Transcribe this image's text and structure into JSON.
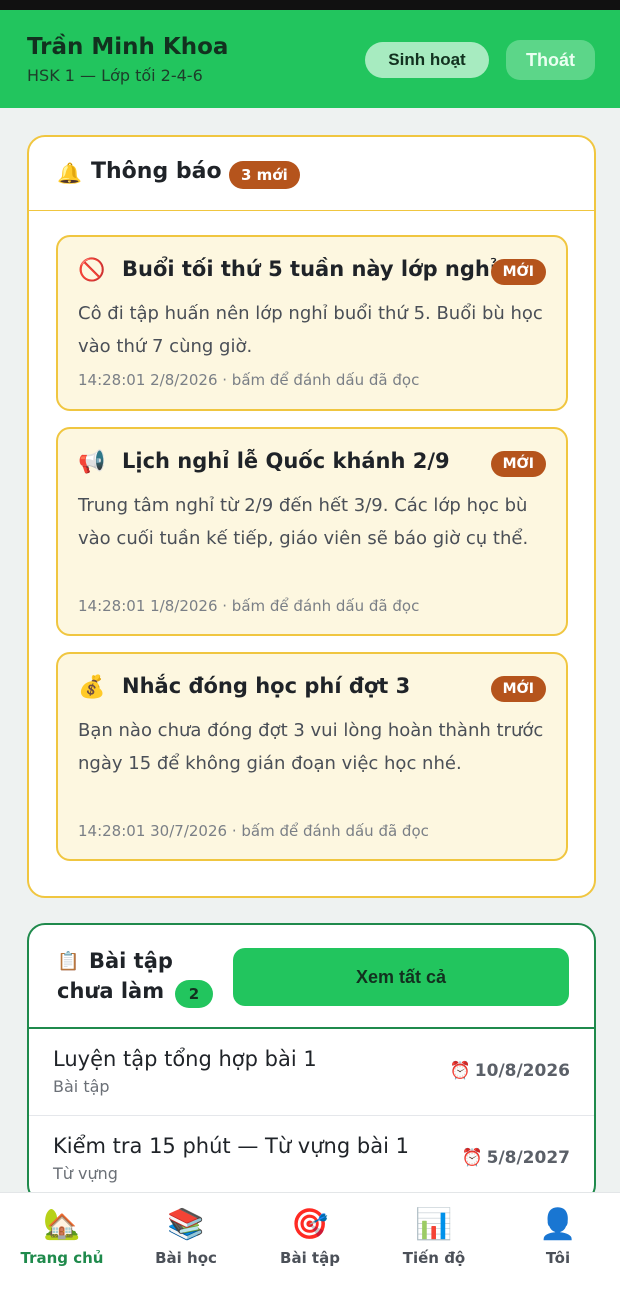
{
  "header": {
    "user_name": "Trần Minh Khoa",
    "class_name": "HSK 1 — Lớp tối 2-4-6",
    "activity_label": "Sinh hoạt",
    "logout_label": "Thoát"
  },
  "notifications": {
    "icon": "bell-icon",
    "title": "Thông báo",
    "count_label": "3 mới",
    "items": [
      {
        "icon": "no-entry-icon",
        "title": "Buổi tối thứ 5 tuần này lớp nghỉ",
        "badge": "MỚI",
        "body": "Cô đi tập huấn nên lớp nghỉ buổi thứ 5. Buổi bù học vào thứ 7 cùng giờ.",
        "meta": "14:28:01 2/8/2026 · bấm để đánh dấu đã đọc"
      },
      {
        "icon": "megaphone-icon",
        "title": "Lịch nghỉ lễ Quốc khánh 2/9",
        "badge": "MỚI",
        "body": "Trung tâm nghỉ từ 2/9 đến hết 3/9. Các lớp học bù vào cuối tuần kế tiếp, giáo viên sẽ báo giờ cụ thể.",
        "meta": "14:28:01 1/8/2026 · bấm để đánh dấu đã đọc"
      },
      {
        "icon": "money-bag-icon",
        "title": "Nhắc đóng học phí đợt 3",
        "badge": "MỚI",
        "body": "Bạn nào chưa đóng đợt 3 vui lòng hoàn thành trước ngày 15 để không gián đoạn việc học nhé.",
        "meta": "14:28:01 30/7/2026 · bấm để đánh dấu đã đọc"
      }
    ]
  },
  "homework": {
    "icon": "clipboard-icon",
    "title_line1": "Bài tập",
    "title_line2": "chưa làm",
    "count": "2",
    "view_all_label": "Xem tất cả",
    "items": [
      {
        "title": "Luyện tập tổng hợp bài 1",
        "subtitle": "Bài tập",
        "due": "10/8/2026"
      },
      {
        "title": "Kiểm tra 15 phút — Từ vựng bài 1",
        "subtitle": "Từ vựng",
        "due": "5/8/2027"
      }
    ]
  },
  "tabbar": {
    "tabs": [
      {
        "label": "Trang chủ",
        "icon": "house-icon",
        "active": true
      },
      {
        "label": "Bài học",
        "icon": "books-icon",
        "active": false
      },
      {
        "label": "Bài tập",
        "icon": "target-icon",
        "active": false
      },
      {
        "label": "Tiến độ",
        "icon": "bar-chart-icon",
        "active": false
      },
      {
        "label": "Tôi",
        "icon": "user-icon",
        "active": false
      }
    ]
  },
  "colors": {
    "header_bg": "#22c55e",
    "notif_border": "#f0c640",
    "badge_bg": "#b5541c",
    "homework_border": "#1f8a4c"
  }
}
